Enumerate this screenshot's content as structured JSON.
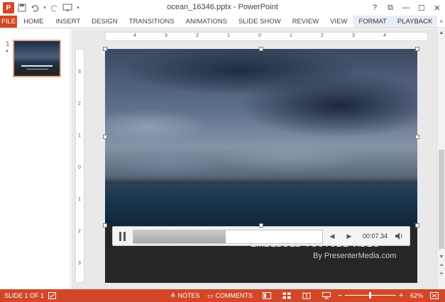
{
  "window": {
    "title": "ocean_16346.pptx - PowerPoint",
    "app_logo": "P",
    "controls": [
      "?",
      "⧉",
      "—",
      "☐",
      "✕"
    ]
  },
  "ribbon": {
    "tabs": [
      {
        "label": "FILE"
      },
      {
        "label": "HOME"
      },
      {
        "label": "INSERT"
      },
      {
        "label": "DESIGN"
      },
      {
        "label": "TRANSITIONS"
      },
      {
        "label": "ANIMATIONS"
      },
      {
        "label": "SLIDE SHOW"
      },
      {
        "label": "REVIEW"
      },
      {
        "label": "VIEW"
      },
      {
        "label": "FORMAT"
      },
      {
        "label": "PLAYBACK"
      }
    ]
  },
  "thumbnails": {
    "slide_number": "1",
    "transition_marker": "*"
  },
  "ruler": {
    "h_ticks": [
      "4",
      "3",
      "2",
      "1",
      "0",
      "1",
      "2",
      "3",
      "4"
    ],
    "v_ticks": [
      "3",
      "2",
      "1",
      "0",
      "1",
      "2",
      "3"
    ]
  },
  "slide": {
    "title": "EMBEDDED YOUTUBE VIDEO",
    "subtitle": "By PresenterMedia.com"
  },
  "media": {
    "time": "00:07.34",
    "progress": 0.49
  },
  "statusbar": {
    "slide_info": "SLIDE 1 OF 1",
    "notes": "NOTES",
    "comments": "COMMENTS",
    "zoom_minus": "−",
    "zoom_plus": "+",
    "zoom": "62%",
    "zoom_fraction": 0.47
  },
  "colors": {
    "accent": "#d24726",
    "ribbon_context_tab": "#e8eef6"
  }
}
